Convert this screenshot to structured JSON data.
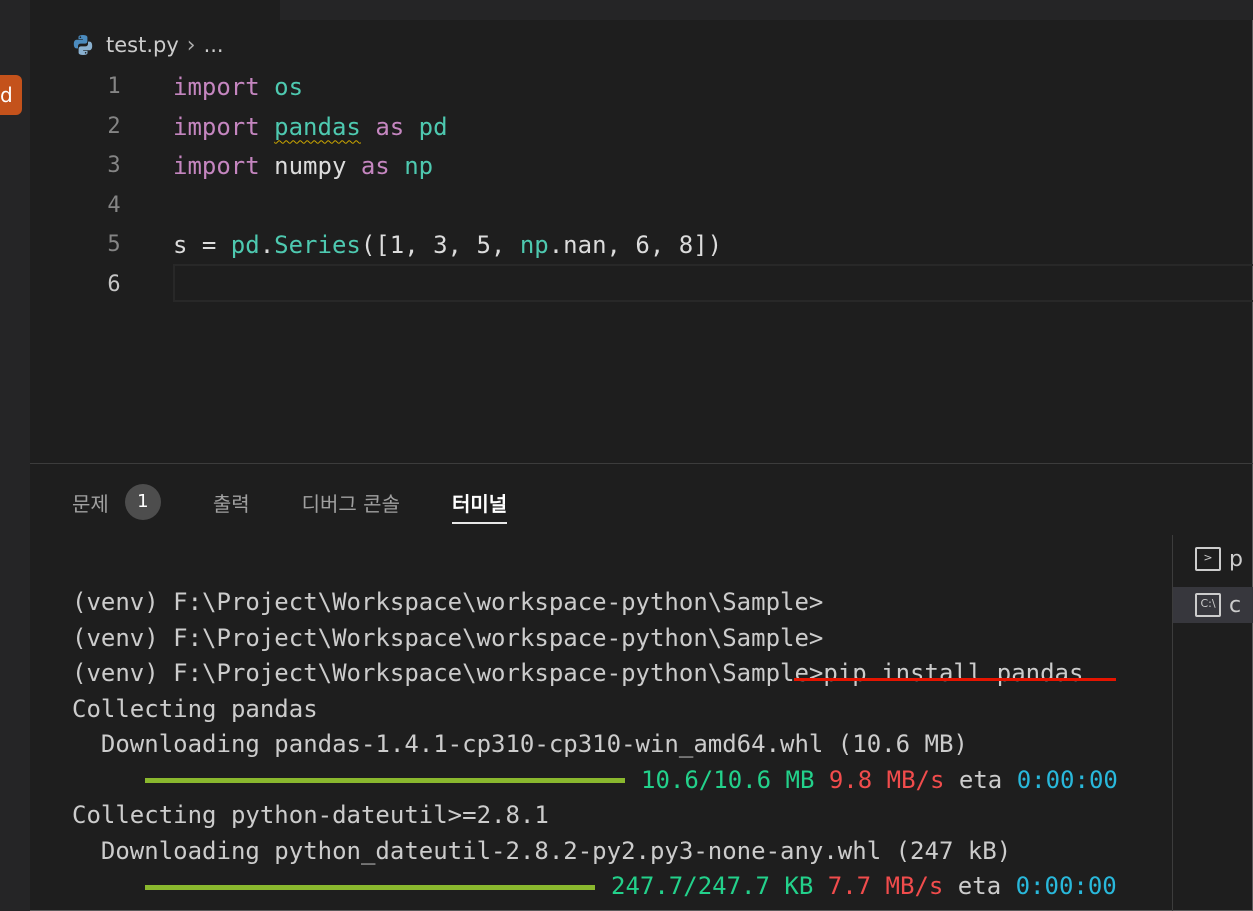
{
  "window": {
    "side_badge": "d"
  },
  "breadcrumb": {
    "file": "test.py",
    "rest": "..."
  },
  "editor": {
    "lines": [
      {
        "num": "1",
        "tokens": [
          {
            "t": "import",
            "c": "kw"
          },
          {
            "t": " "
          },
          {
            "t": "os",
            "c": "mod"
          }
        ]
      },
      {
        "num": "2",
        "tokens": [
          {
            "t": "import",
            "c": "kw"
          },
          {
            "t": " "
          },
          {
            "t": "pandas",
            "c": "mod squig"
          },
          {
            "t": " "
          },
          {
            "t": "as",
            "c": "kw"
          },
          {
            "t": " "
          },
          {
            "t": "pd",
            "c": "mod"
          }
        ]
      },
      {
        "num": "3",
        "tokens": [
          {
            "t": "import",
            "c": "kw"
          },
          {
            "t": " "
          },
          {
            "t": "numpy",
            "c": "id"
          },
          {
            "t": " "
          },
          {
            "t": "as",
            "c": "kw"
          },
          {
            "t": " "
          },
          {
            "t": "np",
            "c": "mod"
          }
        ]
      },
      {
        "num": "4",
        "tokens": []
      },
      {
        "num": "5",
        "tokens": [
          {
            "t": "s = "
          },
          {
            "t": "pd",
            "c": "mod"
          },
          {
            "t": "."
          },
          {
            "t": "Series",
            "c": "mod"
          },
          {
            "t": "([1, 3, 5, "
          },
          {
            "t": "np",
            "c": "mod"
          },
          {
            "t": ".nan, 6, 8])"
          }
        ]
      },
      {
        "num": "6",
        "tokens": [],
        "active": true
      }
    ]
  },
  "panel": {
    "tabs": [
      {
        "label": "문제",
        "badge": "1"
      },
      {
        "label": "출력"
      },
      {
        "label": "디버그 콘솔"
      },
      {
        "label": "터미널",
        "active": true
      }
    ]
  },
  "terminal_list": [
    {
      "icon": "powershell-icon",
      "glyph": ">",
      "label": "p"
    },
    {
      "icon": "cmd-icon",
      "glyph": "C:\\",
      "label": "c",
      "selected": true
    }
  ],
  "terminal": {
    "lines": [
      "(venv) F:\\Project\\Workspace\\workspace-python\\Sample>",
      "(venv) F:\\Project\\Workspace\\workspace-python\\Sample>",
      "(venv) F:\\Project\\Workspace\\workspace-python\\Sample>pip install pandas",
      "Collecting pandas",
      "  Downloading pandas-1.4.1-cp310-cp310-win_amd64.whl (10.6 MB)",
      "Collecting python-dateutil>=2.8.1",
      "  Downloading python_dateutil-2.8.2-py2.py3-none-any.whl (247 kB)"
    ],
    "progress": [
      {
        "size": "10.6/10.6 MB",
        "speed": "9.8 MB/s",
        "eta_label": "eta",
        "eta": "0:00:00",
        "fraction": 1.0
      },
      {
        "size": "247.7/247.7 KB",
        "speed": "7.7 MB/s",
        "eta_label": "eta",
        "eta": "0:00:00",
        "fraction": 1.0
      }
    ]
  },
  "colors": {
    "background": "#1e1e1e",
    "keyword": "#c586c0",
    "module": "#4ec9b0",
    "progress_bar": "#8ab82e",
    "highlight_underline": "#e51400"
  }
}
